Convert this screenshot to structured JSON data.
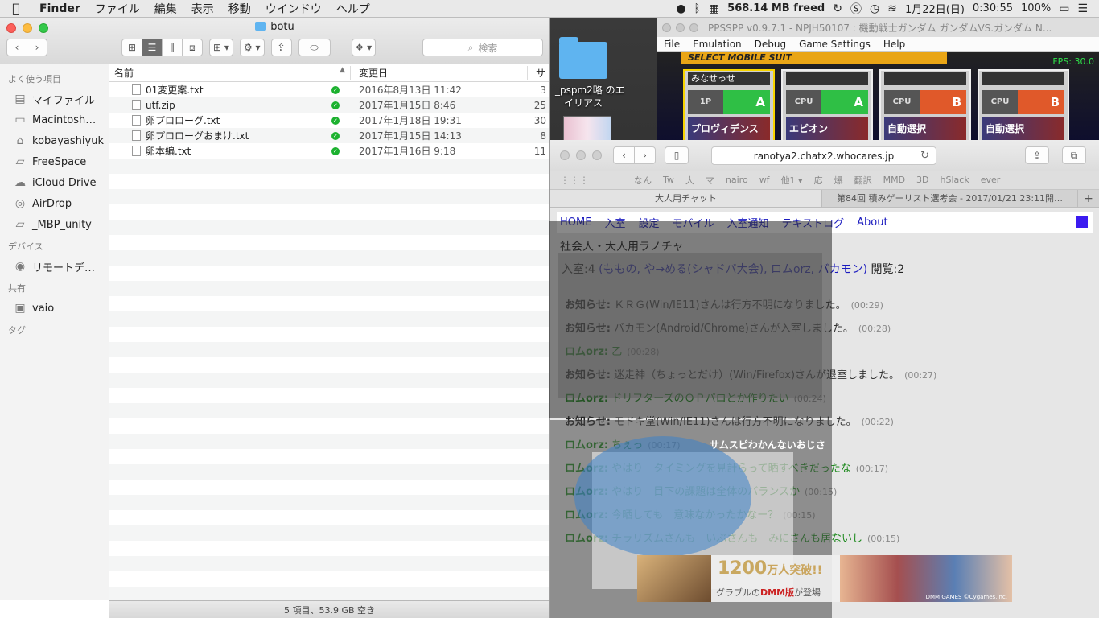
{
  "menubar": {
    "apple": "",
    "items": [
      "Finder",
      "ファイル",
      "編集",
      "表示",
      "移動",
      "ウインドウ",
      "ヘルプ"
    ],
    "memory": "568.14 MB freed",
    "datetime": "1月22日(日)",
    "time": "0:30:55",
    "battery": "100%"
  },
  "desktop": {
    "folder_label_line1": "_pspm2略 のエ",
    "folder_label_line2": "イリアス"
  },
  "finder": {
    "title": "botu",
    "search_placeholder": "検索",
    "sidebar": {
      "favorites_header": "よく使う項目",
      "favorites": [
        "マイファイル",
        "Macintosh…",
        "kobayashiyuk",
        "FreeSpace",
        "iCloud Drive",
        "AirDrop",
        "_MBP_unity"
      ],
      "devices_header": "デバイス",
      "devices": [
        "リモートデ…"
      ],
      "shared_header": "共有",
      "shared": [
        "vaio"
      ],
      "tags_header": "タグ"
    },
    "columns": {
      "name": "名前",
      "date": "変更日",
      "size": "サ"
    },
    "files": [
      {
        "name": "01変更案.txt",
        "date": "2016年8月13日 11:42",
        "size": "3"
      },
      {
        "name": "utf.zip",
        "date": "2017年1月15日 8:46",
        "size": "25"
      },
      {
        "name": "卵プロローグ.txt",
        "date": "2017年1月18日 19:31",
        "size": "30"
      },
      {
        "name": "卵プロローグおまけ.txt",
        "date": "2017年1月15日 14:13",
        "size": "8"
      },
      {
        "name": "卵本編.txt",
        "date": "2017年1月16日 9:18",
        "size": "11"
      }
    ],
    "status": "5 項目、53.9 GB 空き"
  },
  "ppsspp": {
    "title": "PPSSPP v0.9.7.1 - NPJH50107 : 機動戦士ガンダム ガンダムVS.ガンダム N...",
    "menu": [
      "File",
      "Emulation",
      "Debug",
      "Game Settings",
      "Help"
    ],
    "banner": "SELECT MOBILE SUIT",
    "fps": "FPS: 30.0",
    "cards": [
      {
        "name": "みなせっせ",
        "entry": "1P",
        "team": "A",
        "pilot": "プロヴィデンス"
      },
      {
        "name": "",
        "entry": "CPU",
        "team": "A",
        "pilot": "エピオン"
      },
      {
        "name": "",
        "entry": "CPU",
        "team": "B",
        "pilot": "自動選択"
      },
      {
        "name": "",
        "entry": "CPU",
        "team": "B",
        "pilot": "自動選択"
      }
    ]
  },
  "safari": {
    "url": "ranotya2.chatx2.whocares.jp",
    "bookmarks": [
      "なん",
      "Tw",
      "大",
      "マ",
      "nairo",
      "wf",
      "他1 ▾",
      "応",
      "爆",
      "翻訳",
      "MMD",
      "3D",
      "hSlack",
      "ever"
    ],
    "tabs": [
      "大人用チャット",
      "第84回 積みゲーリスト選考会 - 2017/01/21 23:11開…"
    ],
    "chat": {
      "nav": [
        "HOME",
        "入室",
        "設定",
        "モバイル",
        "入室通知",
        "テキストログ",
        "About"
      ],
      "room_name": "社会人・大人用ラノチャ",
      "count_prefix": "入室:4",
      "members": "(ももの, や→める(シャドバ大会), ロムorz, バカモン)",
      "views": "閲覧:2",
      "messages": [
        {
          "type": "notice",
          "who": "お知らせ:",
          "text": "ＫＲＧ(Win/IE11)さんは行方不明になりました。",
          "time": "(00:29)"
        },
        {
          "type": "notice",
          "who": "お知らせ:",
          "text": "バカモン(Android/Chrome)さんが入室しました。",
          "time": "(00:28)"
        },
        {
          "type": "user",
          "who": "ロムorz:",
          "text": "乙",
          "time": "(00:28)"
        },
        {
          "type": "notice",
          "who": "お知らせ:",
          "text": "迷走神（ちょっとだけ）(Win/Firefox)さんが退室しました。",
          "time": "(00:27)"
        },
        {
          "type": "user",
          "who": "ロムorz:",
          "text": "ドリフターズのＯＰパロとか作りたい",
          "time": "(00:24)"
        },
        {
          "type": "notice",
          "who": "お知らせ:",
          "text": "モドキ堂(Win/IE11)さんは行方不明になりました。",
          "time": "(00:22)"
        },
        {
          "type": "user",
          "who": "ロムorz:",
          "text": "ちぇっ",
          "time": "(00:17)"
        },
        {
          "type": "user",
          "who": "ロムorz:",
          "text": "やはり　タイミングを見計らって晒すべきだったな",
          "time": "(00:17)"
        },
        {
          "type": "user",
          "who": "ロムorz:",
          "text": "やはり　目下の課題は全体のバランスか",
          "time": "(00:15)"
        },
        {
          "type": "user",
          "who": "ロムorz:",
          "text": "今晒しても　意味なかったかなー？",
          "time": "(00:15)"
        },
        {
          "type": "user",
          "who": "ロムorz:",
          "text": "チラリズムさんも　いぶさんも　みにさんも居ないし",
          "time": "(00:15)"
        }
      ]
    }
  },
  "overlay": {
    "caption": "サムスピわかんないおじさ"
  },
  "ad": {
    "big": "1200",
    "big_suffix": "万人突破!!",
    "sub_prefix": "グラブルの",
    "sub_brand": "DMM版",
    "sub_suffix": "が登場",
    "copyright": "DMM GAMES ©Cygames,Inc."
  }
}
